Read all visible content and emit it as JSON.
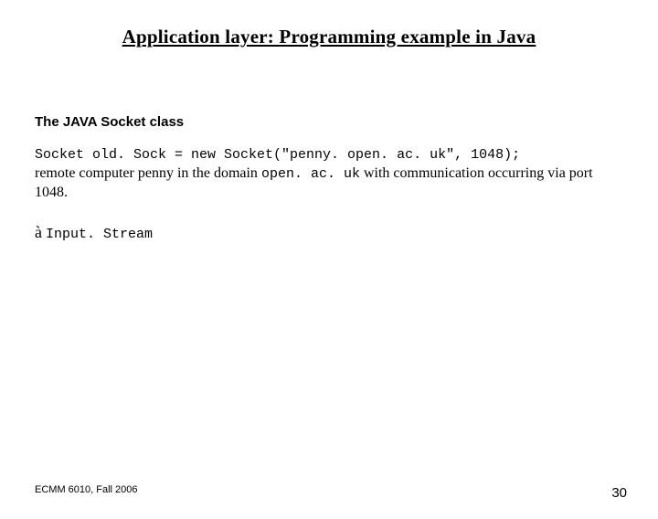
{
  "title": "Application layer: Programming example in Java",
  "subhead": "The JAVA Socket class",
  "codeline": "Socket old. Sock = new Socket(\"penny. open. ac. uk\", 1048);",
  "body_prefix": "remote computer penny in the domain ",
  "body_code": "open. ac. uk",
  "body_suffix": " with communication occurring via port 1048.",
  "arrow": "à",
  "arrow_code": "Input. Stream",
  "footer_left": "ECMM 6010, Fall 2006",
  "footer_right": "30"
}
